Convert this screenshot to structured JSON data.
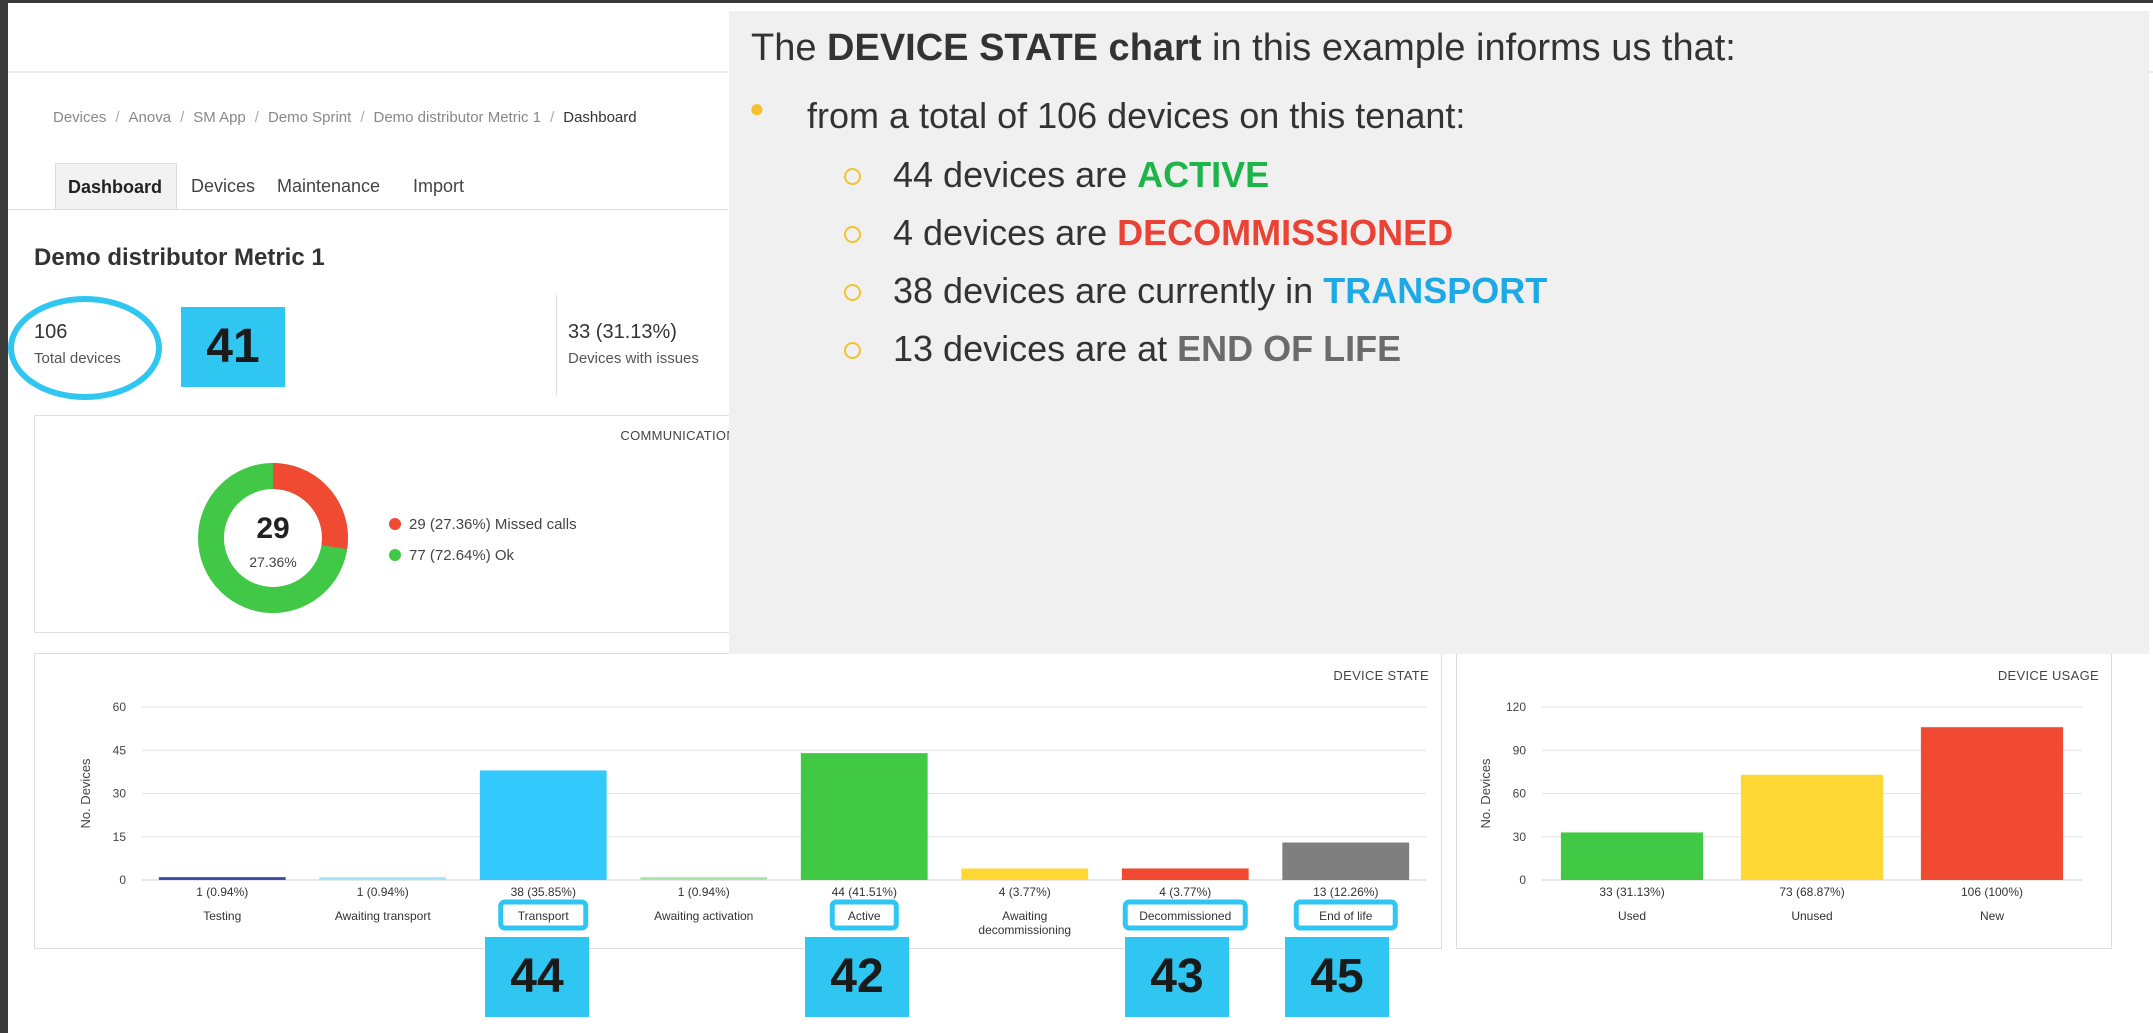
{
  "breadcrumb": [
    "Devices",
    "Anova",
    "SM App",
    "Demo Sprint",
    "Demo distributor Metric 1",
    "Dashboard"
  ],
  "breadcrumb_sep": "/",
  "tabs": [
    {
      "label": "Dashboard",
      "active": true
    },
    {
      "label": "Devices",
      "active": false
    },
    {
      "label": "Maintenance",
      "active": false
    },
    {
      "label": "Import",
      "active": false
    }
  ],
  "page_title": "Demo distributor Metric 1",
  "stats": {
    "total": {
      "value": "106",
      "label": "Total devices"
    },
    "issues": {
      "value": "33 (31.13%)",
      "label": "Devices with issues"
    }
  },
  "callouts": {
    "badge_41": "41",
    "badge_42": "42",
    "badge_43": "43",
    "badge_44": "44",
    "badge_45": "45"
  },
  "communications": {
    "title": "COMMUNICATIONS",
    "center_value": "29",
    "center_pct": "27.36%",
    "legend": [
      {
        "label": "29 (27.36%) Missed calls",
        "color": "#f04a33"
      },
      {
        "label": "77 (72.64%) Ok",
        "color": "#40c846"
      }
    ]
  },
  "overlay": {
    "title_pre": "The ",
    "title_bold": "DEVICE STATE chart",
    "title_post": " in this example informs us that:",
    "bullet": "from a total of 106 devices on this tenant:",
    "items": [
      {
        "pre": "44 devices are ",
        "key": "ACTIVE",
        "color": "#1db44a"
      },
      {
        "pre": "4 devices are ",
        "key": "DECOMMISSIONED",
        "color": "#ea4335"
      },
      {
        "pre": "38 devices are currently in ",
        "key": "TRANSPORT",
        "color": "#1ca9e6"
      },
      {
        "pre": "13 devices are at ",
        "key": "END OF LIFE",
        "color": "#6b6b6b"
      }
    ]
  },
  "chart_data": [
    {
      "type": "bar",
      "title": "DEVICE STATE",
      "ylabel": "No. Devices",
      "ylim": [
        0,
        60
      ],
      "yticks": [
        0,
        15,
        30,
        45,
        60
      ],
      "categories": [
        "Testing",
        "Awaiting transport",
        "Transport",
        "Awaiting activation",
        "Active",
        "Awaiting decommissioning",
        "Decommissioned",
        "End of life"
      ],
      "values": [
        1,
        1,
        38,
        1,
        44,
        4,
        4,
        13
      ],
      "value_labels": [
        "1 (0.94%)",
        "1 (0.94%)",
        "38 (35.85%)",
        "1 (0.94%)",
        "44 (41.51%)",
        "4 (3.77%)",
        "4 (3.77%)",
        "13 (12.26%)"
      ],
      "colors": [
        "#3b4fa8",
        "#a6e4fb",
        "#33c9fc",
        "#a9e7a8",
        "#41c845",
        "#fdd835",
        "#f04a33",
        "#7f7f7f"
      ],
      "highlighted": [
        "Transport",
        "Active",
        "Decommissioned",
        "End of life"
      ],
      "grid": true
    },
    {
      "type": "bar",
      "title": "DEVICE USAGE",
      "ylabel": "No. Devices",
      "ylim": [
        0,
        120
      ],
      "yticks": [
        0,
        30,
        60,
        90,
        120
      ],
      "categories": [
        "Used",
        "Unused",
        "New"
      ],
      "values": [
        33,
        73,
        106
      ],
      "value_labels": [
        "33 (31.13%)",
        "73 (68.87%)",
        "106 (100%)"
      ],
      "colors": [
        "#41c845",
        "#fdd835",
        "#f04a33"
      ],
      "grid": true
    }
  ]
}
